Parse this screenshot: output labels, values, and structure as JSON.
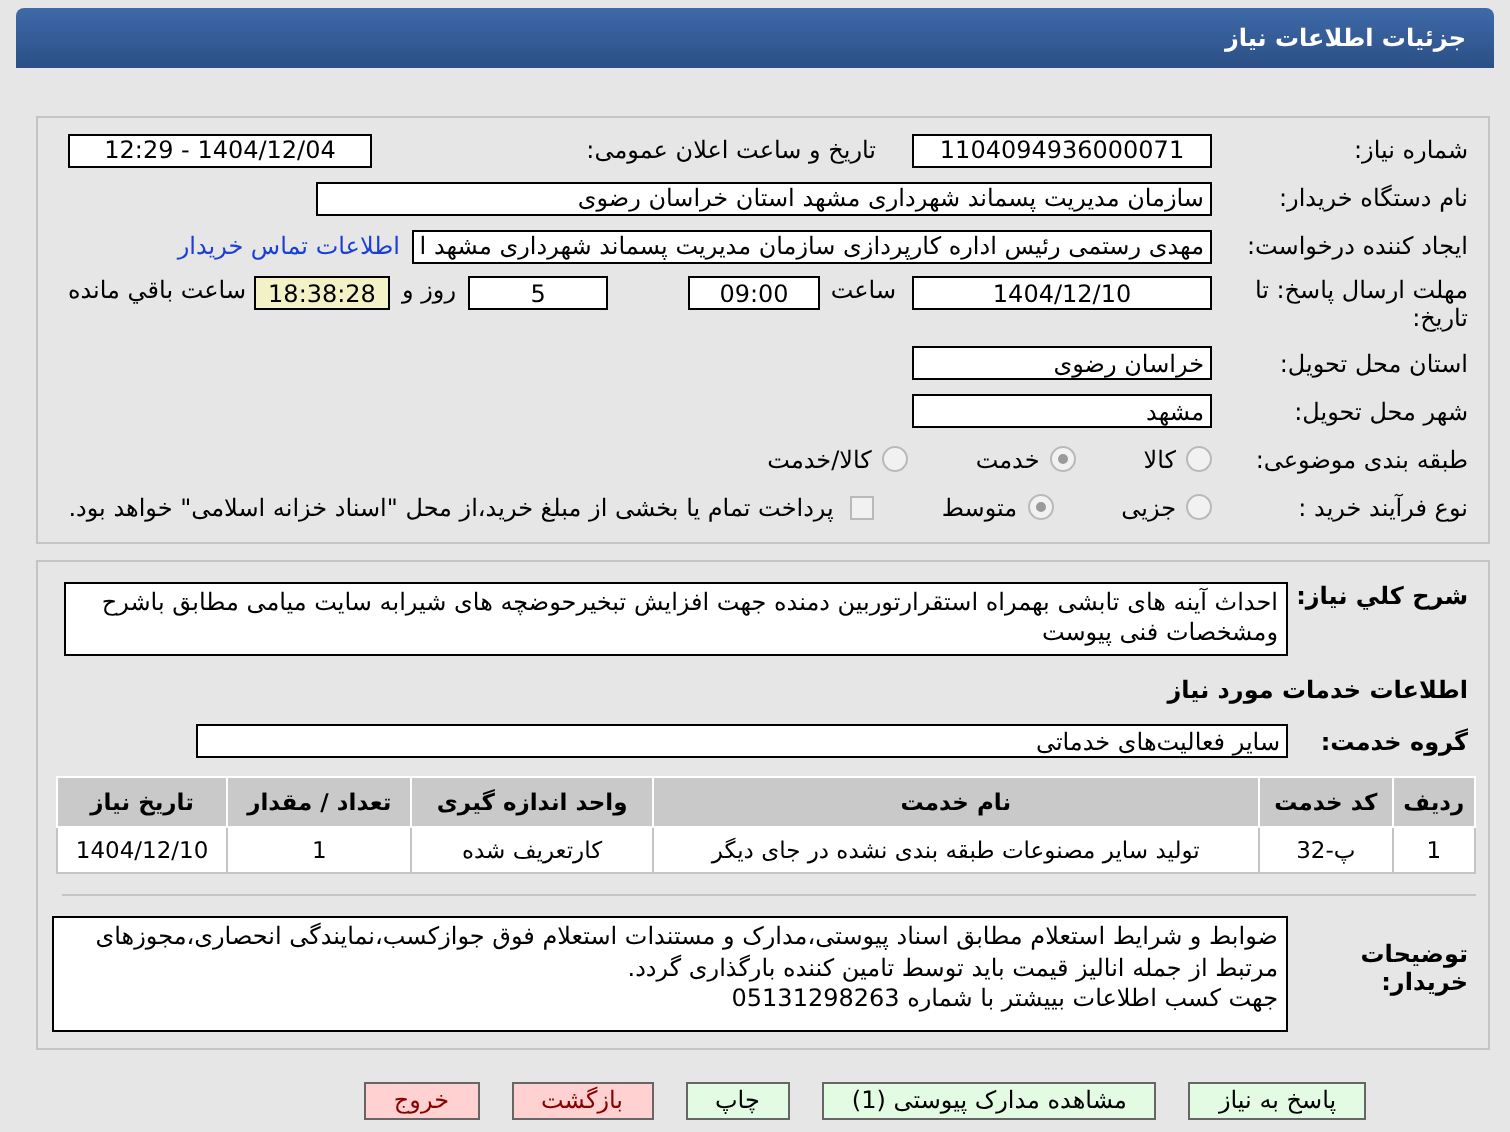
{
  "header": {
    "title": "جزئیات اطلاعات نیاز"
  },
  "need_number": {
    "label": "شماره نیاز:",
    "value": "1104094936000071"
  },
  "announce": {
    "label": "تاریخ و ساعت اعلان عمومی:",
    "value": "1404/12/04 - 12:29"
  },
  "buyer": {
    "label": "نام دستگاه خریدار:",
    "value": "سازمان مدیریت پسماند شهرداری مشهد استان خراسان رضوی"
  },
  "requester": {
    "label": "ایجاد کننده درخواست:",
    "value": "مهدی رستمی رئیس اداره کارپردازی سازمان مدیریت پسماند شهرداری مشهد ا",
    "link": "اطلاعات تماس خریدار"
  },
  "deadline": {
    "label": "مهلت ارسال پاسخ: تا تاریخ:",
    "date": "1404/12/10",
    "time_label": "ساعت",
    "time": "09:00",
    "days": "5",
    "days_label": "روز و",
    "remaining": "18:38:28",
    "remaining_label": "ساعت باقي مانده"
  },
  "province": {
    "label": "استان محل تحویل:",
    "value": "خراسان رضوی"
  },
  "city": {
    "label": "شهر محل تحویل:",
    "value": "مشهد"
  },
  "category": {
    "label": "طبقه بندی موضوعی:",
    "options": [
      {
        "label": "کالا",
        "selected": false
      },
      {
        "label": "خدمت",
        "selected": true
      },
      {
        "label": "کالا/خدمت",
        "selected": false
      }
    ]
  },
  "process": {
    "label": "نوع فرآیند خرید :",
    "options": [
      {
        "label": "جزیی",
        "selected": false
      },
      {
        "label": "متوسط",
        "selected": true
      }
    ],
    "payment": {
      "checked": false,
      "text": "پرداخت تمام يا بخشی از مبلغ خرید،از محل \"اسناد خزانه اسلامی\" خواهد بود."
    }
  },
  "description": {
    "label": "شرح کلي نياز:",
    "value": "احداث آینه های تابشی بهمراه استقرارتوربین دمنده جهت افزایش تبخیرحوضچه های شیرابه سایت میامی مطابق باشرح ومشخصات فنی پیوست"
  },
  "services_title": "اطلاعات خدمات مورد نیاز",
  "service_group": {
    "label": "گروه خدمت:",
    "value": "سایر فعالیت‌های خدماتی"
  },
  "table": {
    "columns": [
      "ردیف",
      "کد خدمت",
      "نام خدمت",
      "واحد اندازه گیری",
      "تعداد / مقدار",
      "تاریخ نیاز"
    ],
    "rows": [
      [
        "1",
        "پ-32",
        "تولید سایر مصنوعات طبقه بندی نشده در جای دیگر",
        "کارتعریف شده",
        "1",
        "1404/12/10"
      ]
    ]
  },
  "notes": {
    "label": "توضیحات خریدار:",
    "lines": [
      "ضوابط و شرایط استعلام مطابق اسناد پیوستی،مدارک و مستندات استعلام فوق جوازکسب،نمایندگی انحصاری،مجوزهای مرتبط از جمله انالیز قیمت باید توسط تامین کننده بارگذاری گردد.",
      "جهت کسب اطلاعات بییشتر با شماره 05131298263"
    ]
  },
  "buttons": [
    {
      "label": "پاسخ به نیاز",
      "kind": "primary"
    },
    {
      "label": "مشاهده مدارک پیوستی (1)",
      "kind": "primary"
    },
    {
      "label": "چاپ",
      "kind": "primary"
    },
    {
      "label": "بازگشت",
      "kind": "danger"
    },
    {
      "label": "خروج",
      "kind": "danger"
    }
  ]
}
